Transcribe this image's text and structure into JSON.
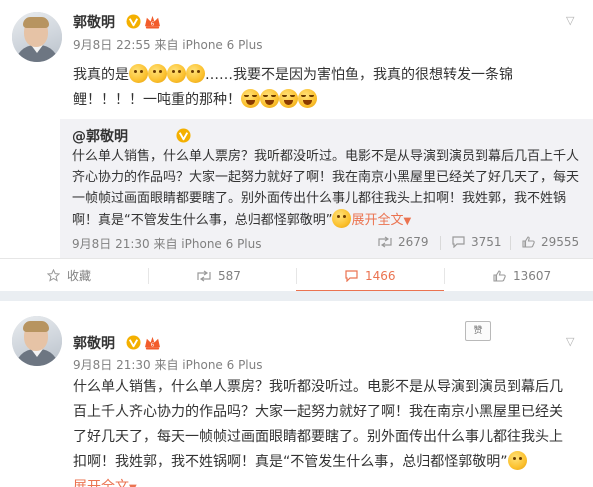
{
  "post1": {
    "author": "郭敬明",
    "meta": "9月8日 22:55 来自 iPhone 6 Plus",
    "text_parts": {
      "a": "我真的是",
      "b": "……我要不是因为害怕鱼，我真的很想转发一条锦",
      "c": "鲤！！！！一吨重的那种！"
    },
    "repost": {
      "author": "@郭敬明",
      "text": "什么单人销售，什么单人票房？我听都没听过。电影不是从导演到演员到幕后几百上千人齐心协力的作品吗？大家一起努力就好了啊！我在南京小黑屋里已经关了好几天了，每天一帧帧过画面眼睛都要瞎了。别外面传出什么事儿都往我头上扣啊！我姓郭，我不姓锅啊！真是“不管发生什么事，总归都怪郭敬明”",
      "expand": "展开全文",
      "meta": "9月8日 21:30 来自 iPhone 6 Plus",
      "reposts": "2679",
      "comments": "3751",
      "likes": "29555"
    },
    "actions": {
      "favorite": "收藏",
      "repost": "587",
      "comment": "1466",
      "like": "13607"
    }
  },
  "post2": {
    "author": "郭敬明",
    "meta": "9月8日 21:30 来自 iPhone 6 Plus",
    "text": "什么单人销售，什么单人票房？我听都没听过。电影不是从导演到演员到幕后几百上千人齐心协力的作品吗？大家一起努力就好了啊！我在南京小黑屋里已经关了好几天了，每天一帧帧过画面眼睛都要瞎了。别外面传出什么事儿都往我头上扣啊！我姓郭，我不姓锅啊！真是“不管发生什么事，总归都怪郭敬明”",
    "expand": "展开全文",
    "qr_label": "赞"
  },
  "colors": {
    "accent": "#eb7350",
    "verified": "#f4b000",
    "meta": "#808080",
    "divider": "#eaeef2"
  },
  "icons": [
    "verified-v-icon",
    "vip-crown-icon",
    "chevron-down-icon",
    "repost-icon",
    "comment-icon",
    "like-icon",
    "favorite-star-icon",
    "emoji-icon"
  ]
}
